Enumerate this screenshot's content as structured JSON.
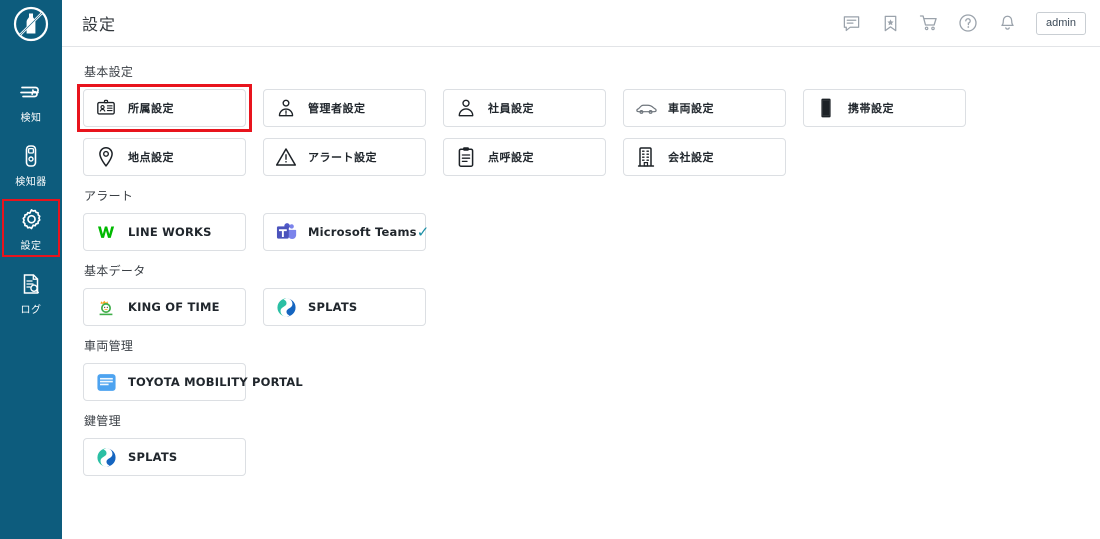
{
  "app": {
    "logo_icon": "no-alcohol-bottle-icon",
    "brand_color": "#0d5c7d",
    "highlight_color": "#e8141d",
    "check_color": "#1b8fa6"
  },
  "sidebar": {
    "items": [
      {
        "label": "検知",
        "icon": "breath-flow-icon",
        "selected": false
      },
      {
        "label": "検知器",
        "icon": "breathalyzer-device-icon",
        "selected": false
      },
      {
        "label": "設定",
        "icon": "gear-icon",
        "selected": true
      },
      {
        "label": "ログ",
        "icon": "log-document-icon",
        "selected": false
      }
    ]
  },
  "header": {
    "title": "設定",
    "icons": [
      {
        "name": "message-icon"
      },
      {
        "name": "bookmark-icon"
      },
      {
        "name": "cart-icon"
      },
      {
        "name": "help-icon"
      },
      {
        "name": "bell-icon"
      }
    ],
    "account_label": "admin"
  },
  "main": {
    "sections": [
      {
        "title": "基本設定",
        "rows": [
          [
            {
              "label": "所属設定",
              "icon": "id-card-icon",
              "jp": true,
              "highlighted": true
            },
            {
              "label": "管理者設定",
              "icon": "admin-user-icon",
              "jp": true
            },
            {
              "label": "社員設定",
              "icon": "user-icon",
              "jp": true
            },
            {
              "label": "車両設定",
              "icon": "car-icon",
              "jp": true
            },
            {
              "label": "携帯設定",
              "icon": "mobile-phone-icon",
              "jp": true
            }
          ],
          [
            {
              "label": "地点設定",
              "icon": "map-pin-icon",
              "jp": true
            },
            {
              "label": "アラート設定",
              "icon": "warning-triangle-icon",
              "jp": true
            },
            {
              "label": "点呼設定",
              "icon": "clipboard-icon",
              "jp": true
            },
            {
              "label": "会社設定",
              "icon": "building-icon",
              "jp": true
            }
          ]
        ]
      },
      {
        "title": "アラート",
        "rows": [
          [
            {
              "label": "LINE WORKS",
              "icon": "line-works-logo"
            },
            {
              "label": "Microsoft Teams",
              "icon": "microsoft-teams-logo",
              "checked": true,
              "check": "✓"
            }
          ]
        ]
      },
      {
        "title": "基本データ",
        "rows": [
          [
            {
              "label": "KING OF TIME",
              "icon": "king-of-time-logo"
            },
            {
              "label": "SPLATS",
              "icon": "splats-logo"
            }
          ]
        ]
      },
      {
        "title": "車両管理",
        "rows": [
          [
            {
              "label": "TOYOTA MOBILITY PORTAL",
              "icon": "toyota-mobility-portal-logo",
              "wide": true
            }
          ]
        ]
      },
      {
        "title": "鍵管理",
        "rows": [
          [
            {
              "label": "SPLATS",
              "icon": "splats-logo"
            }
          ]
        ]
      }
    ]
  }
}
